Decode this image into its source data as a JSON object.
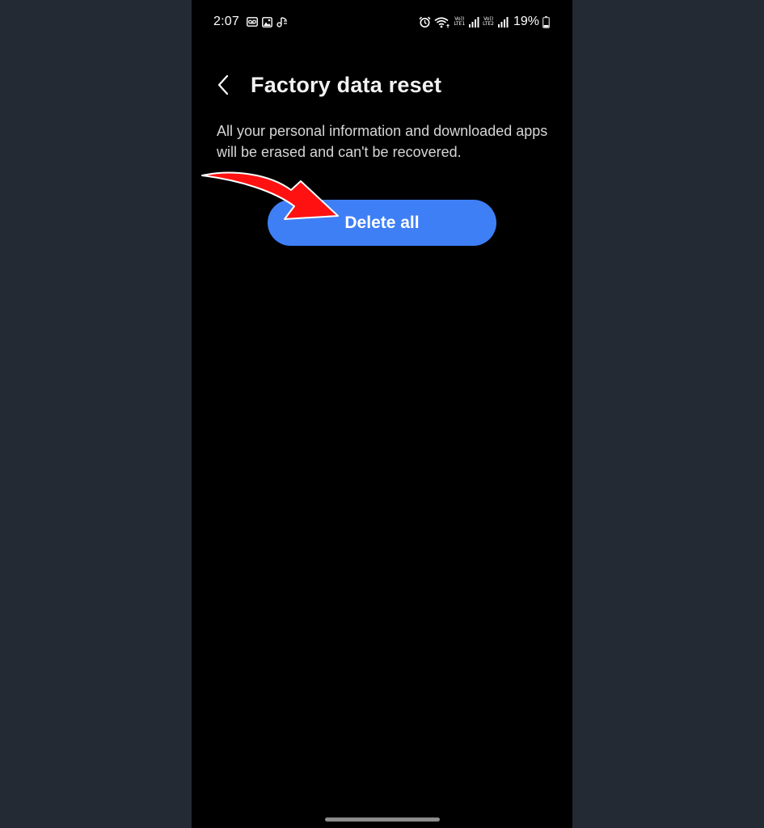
{
  "status_bar": {
    "time": "2:07",
    "left_icons": [
      "voicemail-icon",
      "gallery-icon",
      "music-icon"
    ],
    "right_icons": [
      "alarm-icon",
      "wifi-icon",
      "signal-sim1-icon",
      "signal-sim2-icon",
      "battery-icon"
    ],
    "sim1_label_top": "Vo))",
    "sim1_label_bottom": "LTE1",
    "sim2_label_top": "Vo))",
    "sim2_label_bottom": "LTE2",
    "battery_percent": "19%"
  },
  "header": {
    "back_icon": "chevron-left-icon",
    "title": "Factory data reset"
  },
  "description": "All your personal information and downloaded apps will be erased and can't be recovered.",
  "actions": {
    "delete_label": "Delete all"
  },
  "annotation": {
    "arrow_icon": "red-curved-arrow",
    "arrow_color": "#ff1111"
  },
  "colors": {
    "page_background": "#232a34",
    "screen_background": "#000000",
    "accent": "#3e7ff6"
  }
}
